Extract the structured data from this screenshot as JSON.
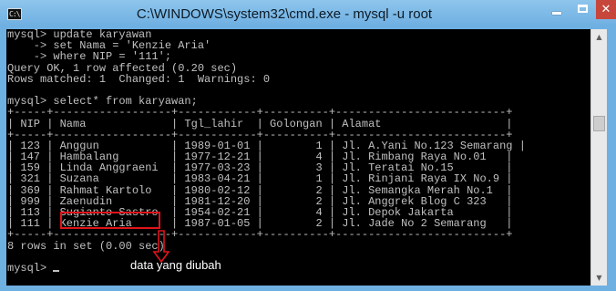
{
  "window": {
    "title": "C:\\WINDOWS\\system32\\cmd.exe - mysql  -u root",
    "icon_text": "C:\\",
    "min_glyph": "minimize-icon",
    "max_glyph": "maximize-icon",
    "close_glyph": "✕"
  },
  "console": {
    "lines": [
      "mysql> update karyawan",
      "    -> set Nama = 'Kenzie Aria'",
      "    -> where NIP = '111';",
      "Query OK, 1 row affected (0.20 sec)",
      "Rows matched: 1  Changed: 1  Warnings: 0",
      "",
      "mysql> select* from karyawan;",
      "+-----+------------------+------------+----------+--------------------------+",
      "| NIP | Nama             | Tgl_lahir  | Golongan | Alamat                   |",
      "+-----+------------------+------------+----------+--------------------------+",
      "| 123 | Anggun           | 1989-01-01 |        1 | Jl. A.Yani No.123 Semarang |",
      "| 147 | Hambalang        | 1977-12-21 |        4 | Jl. Rimbang Raya No.01   |",
      "| 159 | Linda Anggraeni  | 1977-03-23 |        3 | Jl. Teratai No.15        |",
      "| 321 | Suzana           | 1983-04-21 |        1 | Jl. Rinjani Raya IX No.9 |",
      "| 369 | Rahmat Kartolo   | 1980-02-12 |        2 | Jl. Semangka Merah No.1  |",
      "| 999 | Zaenudin         | 1981-12-20 |        2 | Jl. Anggrek Blog C 323   |",
      "| 113 | Sugianto Sastro  | 1954-02-21 |        4 | Jl. Depok Jakarta        |",
      "| 111 | Kenzie Aria      | 1987-01-05 |        2 | Jl. Jade No 2 Semarang   |",
      "+-----+------------------+------------+----------+--------------------------+",
      "8 rows in set (0.00 sec)",
      "",
      "mysql> "
    ]
  },
  "annotation": {
    "label": "data yang diubah",
    "highlight_color": "#e0141b"
  },
  "colors": {
    "console_bg": "#000000",
    "console_fg": "#c0c0c0",
    "titlebar": "#6fb0e2",
    "close_button": "#c7463b"
  }
}
